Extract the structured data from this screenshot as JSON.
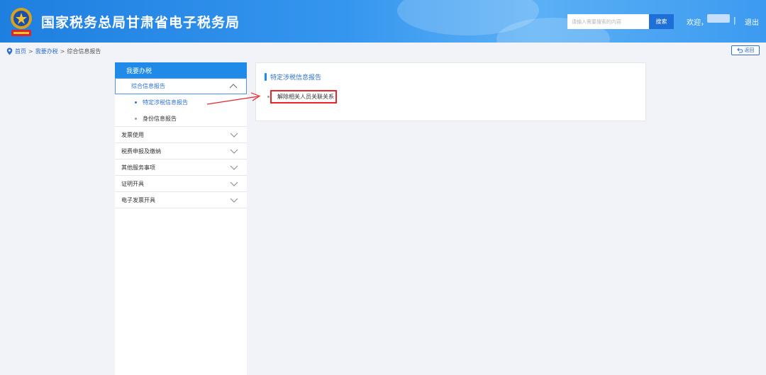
{
  "header": {
    "site_title": "国家税务总局甘肃省电子税务局",
    "search_placeholder": "请输入需要搜索的内容",
    "search_label": "搜索",
    "welcome": "欢迎，",
    "separator": "|",
    "logout": "退出"
  },
  "breadcrumb": {
    "home": "首页",
    "sep1": ">",
    "level1": "我要办税",
    "sep2": ">",
    "current": "综合信息报告"
  },
  "back_label": "返回",
  "sidebar": {
    "header": "我要办税",
    "expanded": {
      "label": "综合信息报告",
      "children": [
        "特定涉税信息报告",
        "身份信息报告"
      ]
    },
    "items": [
      "发票使用",
      "税费申报及缴纳",
      "其他服务事项",
      "证明开具",
      "电子发票开具"
    ]
  },
  "panel": {
    "title": "特定涉税信息报告",
    "link": "解除相关人员关联关系"
  },
  "colors": {
    "primary": "#1f8ae8",
    "link": "#2f6fd0",
    "highlight_border": "#e8262a"
  }
}
